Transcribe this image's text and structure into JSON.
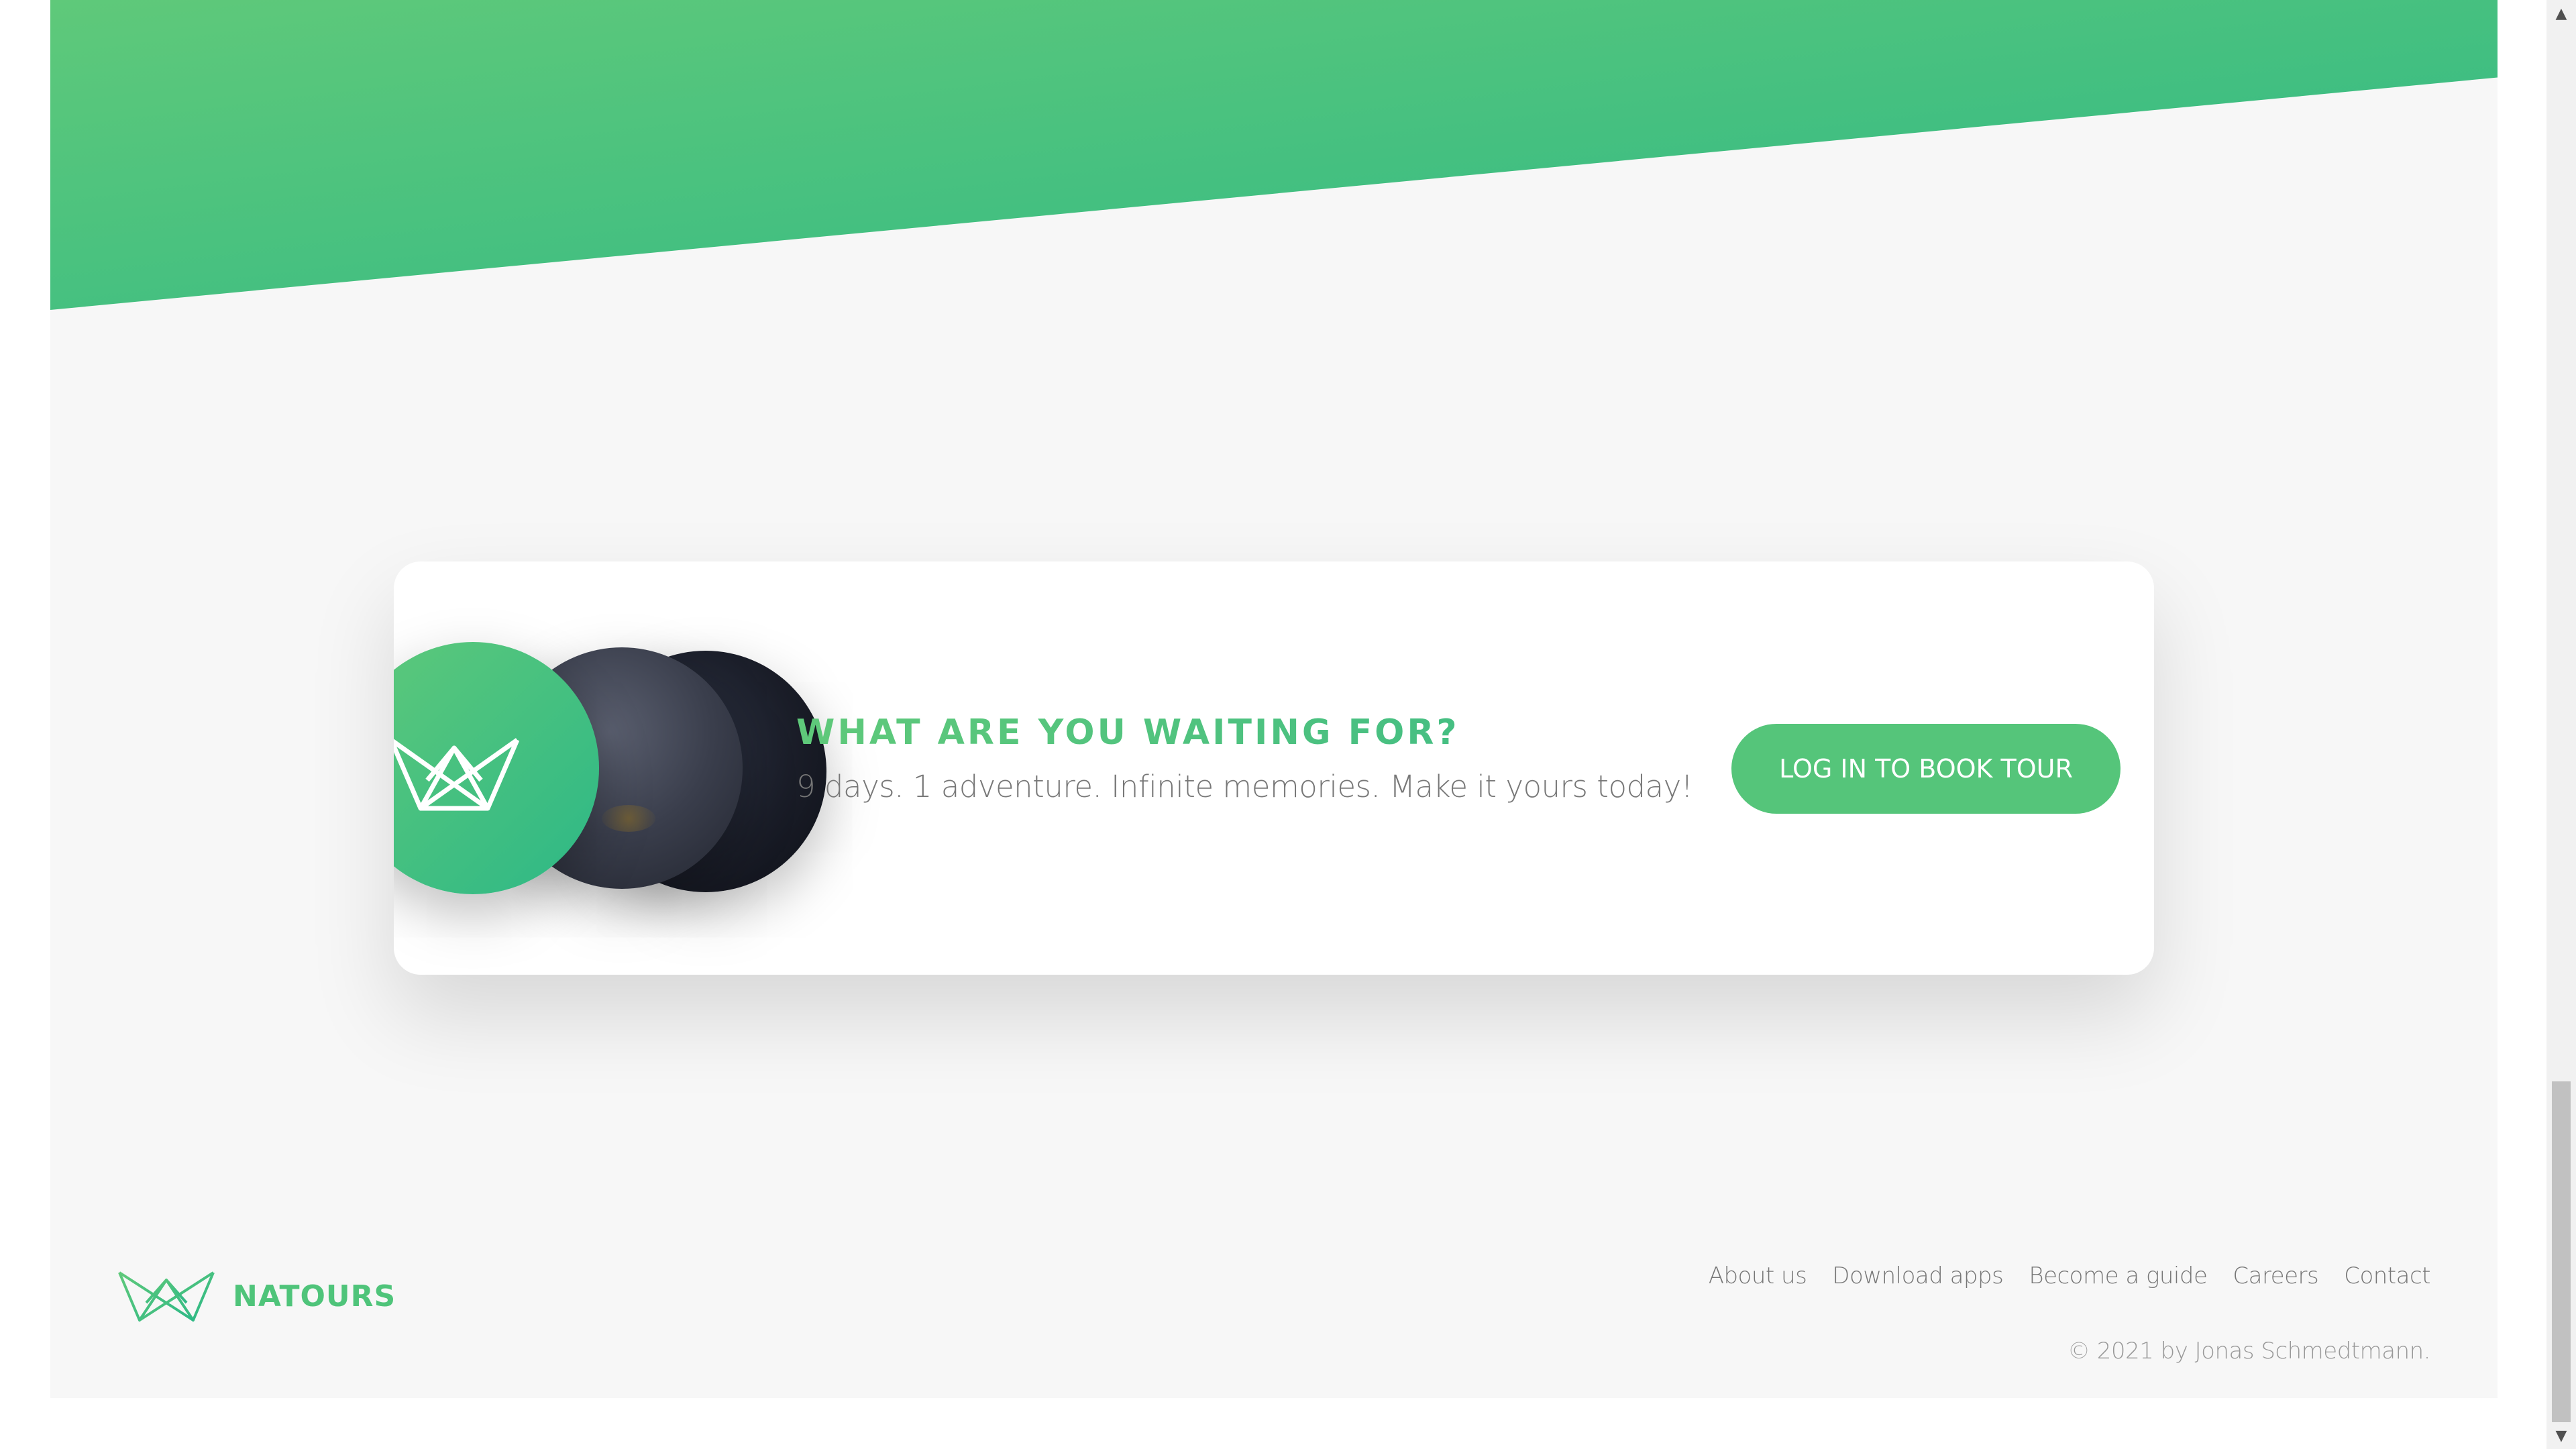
{
  "cta": {
    "heading": "WHAT ARE YOU WAITING FOR?",
    "text": "9 days. 1 adventure. Infinite memories. Make it yours today!",
    "button_label": "LOG IN TO BOOK TOUR"
  },
  "footer": {
    "logo_text": "NATOURS",
    "nav": [
      {
        "label": "About us"
      },
      {
        "label": "Download apps"
      },
      {
        "label": "Become a guide"
      },
      {
        "label": "Careers"
      },
      {
        "label": "Contact"
      }
    ],
    "copyright": "© 2021 by Jonas Schmedtmann."
  },
  "colors": {
    "brand_green": "#55c57a",
    "brand_green_dark": "#28b485",
    "background": "#f7f7f7"
  },
  "icons": {
    "logo": "natours-crown-logo-icon",
    "scroll_up": "scroll-up-arrow-icon",
    "scroll_down": "scroll-down-arrow-icon"
  }
}
